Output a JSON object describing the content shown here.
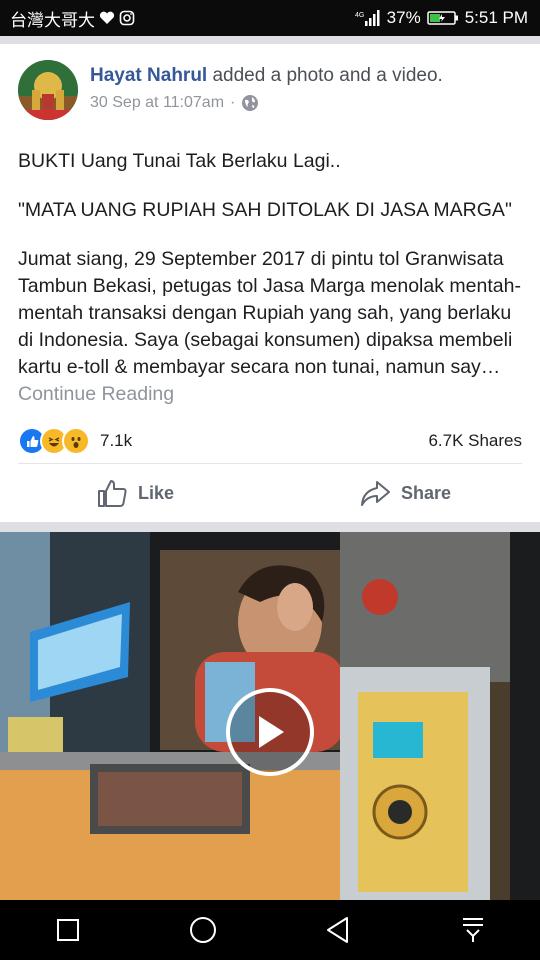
{
  "status_bar": {
    "carrier": "台灣大哥大",
    "signal": "4G",
    "battery_percent": "37%",
    "time": "5:51 PM"
  },
  "post": {
    "author": "Hayat Nahrul",
    "action": " added a photo and a video.",
    "timestamp": "30 Sep at 11:07am",
    "audience_separator": "·",
    "paragraphs": [
      "BUKTI Uang Tunai Tak Berlaku Lagi..",
      "\"MATA UANG RUPIAH SAH DITOLAK DI JASA MARGA\"",
      "Jumat siang, 29 September 2017 di pintu tol Granwisata Tambun Bekasi, petugas tol Jasa Marga menolak mentah-mentah transaksi dengan Rupiah yang sah, yang berlaku di Indonesia. Saya (sebagai konsumen) dipaksa membeli kartu e-toll & membayar secara non tunai, namun say… "
    ],
    "continue_label": "Continue Reading",
    "reaction_count": "7.1k",
    "shares": "6.7K Shares",
    "like_label": "Like",
    "share_label": "Share"
  },
  "colors": {
    "link_blue": "#365899",
    "meta_gray": "#90949c",
    "like_blue": "#1877f2",
    "haha_yellow": "#f7b928"
  },
  "icons": [
    "globe-icon",
    "like-reaction-icon",
    "haha-reaction-icon",
    "wow-reaction-icon",
    "thumbs-up-icon",
    "share-arrow-icon",
    "play-icon",
    "nav-square-icon",
    "nav-circle-icon",
    "nav-back-icon",
    "nav-notification-icon"
  ]
}
